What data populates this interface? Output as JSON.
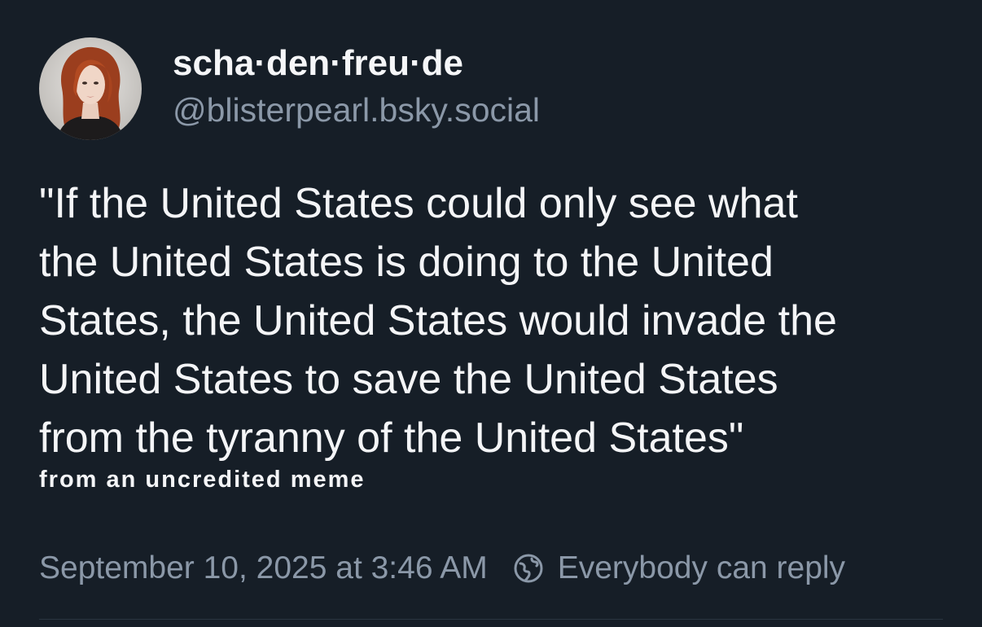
{
  "author": {
    "display_name": "scha·den·freu·de",
    "handle": "@blisterpearl.bsky.social",
    "avatar_icon": "profile-photo"
  },
  "post": {
    "text_lines": [
      "\"If the United States could only see what",
      "the United States is doing to the United",
      "States, the United States would invade the",
      "United States to save the United States",
      "from the tyranny of the United States\""
    ],
    "attribution": "from an uncredited meme"
  },
  "meta": {
    "timestamp": "September 10, 2025 at 3:46 AM",
    "reply_setting": "Everybody can reply",
    "reply_icon": "globe-icon"
  },
  "colors": {
    "background": "#161e27",
    "text": "#f4f5f7",
    "muted": "#8b98a8"
  }
}
